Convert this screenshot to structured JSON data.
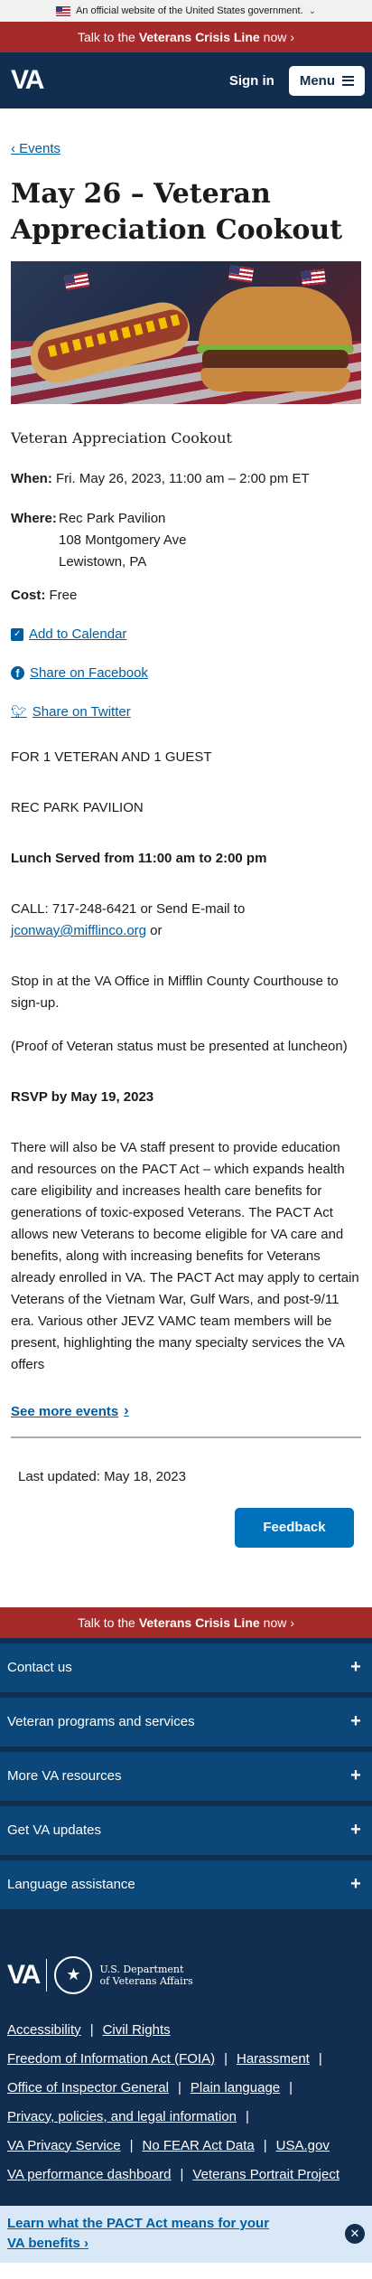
{
  "gov_banner": {
    "text": "An official website of the United States government."
  },
  "crisis_line": {
    "prefix": "Talk to the ",
    "bold": "Veterans Crisis Line",
    "suffix": " now",
    "arrow": "›"
  },
  "header": {
    "logo": "VA",
    "sign_in": "Sign in",
    "menu": "Menu"
  },
  "breadcrumb": {
    "back": "‹",
    "label": "Events"
  },
  "page": {
    "title": "May 26 – Veteran Appreciation Cookout",
    "subtitle": "Veteran Appreciation Cookout",
    "when_label": "When:",
    "when_value": "Fri. May 26, 2023, 11:00 am – 2:00 pm ET",
    "where_label": "Where:",
    "where_lines": [
      "Rec Park Pavilion",
      "108 Montgomery Ave",
      "Lewistown, PA"
    ],
    "cost_label": "Cost:",
    "cost_value": "Free",
    "add_calendar": "Add to Calendar",
    "share_facebook": "Share on Facebook",
    "share_twitter": "Share on Twitter"
  },
  "body": {
    "p1": "FOR 1 VETERAN AND 1 GUEST",
    "p2": "REC PARK PAVILION",
    "p3": "Lunch Served from 11:00 am to 2:00 pm",
    "p4_prefix": " CALL: 717-248-6421 or Send E-mail to ",
    "p4_link": "jconway@mifflinco.org",
    "p4_suffix": " or",
    "p5": "Stop in at the VA Office in Mifflin County Courthouse to sign-up.",
    "p6": "(Proof of Veteran status must be presented at luncheon)",
    "p7": "RSVP by May 19, 2023",
    "p8": "There will also be VA staff present to provide education and resources on the PACT Act – which expands health care eligibility and increases health care benefits for generations of toxic-exposed Veterans. The PACT Act allows new Veterans to become eligible for VA care and benefits, along with increasing benefits for Veterans already enrolled in VA. The PACT Act may apply to certain Veterans of the Vietnam War, Gulf Wars, and post-9/11 era. Various other JEVZ VAMC team members will be present, highlighting the many specialty services the VA offers",
    "see_more": "See more events"
  },
  "last_updated": "Last updated: May 18, 2023",
  "feedback": "Feedback",
  "footer": {
    "accordion": [
      "Contact us",
      "Veteran programs and services",
      "More VA resources",
      "Get VA updates",
      "Language assistance"
    ],
    "dept_line1": "U.S. Department",
    "dept_line2": "of Veterans Affairs",
    "link_rows": [
      [
        "Accessibility",
        "Civil Rights"
      ],
      [
        "Freedom of Information Act (FOIA)",
        "Harassment"
      ],
      [
        "Office of Inspector General",
        "Plain language"
      ],
      [
        "Privacy, policies, and legal information"
      ],
      [
        "VA Privacy Service",
        "No FEAR Act Data",
        "USA.gov"
      ],
      [
        "VA performance dashboard",
        "Veterans Portrait Project"
      ]
    ]
  },
  "pact_banner": {
    "text": "Learn what the PACT Act means for your VA benefits ›"
  }
}
